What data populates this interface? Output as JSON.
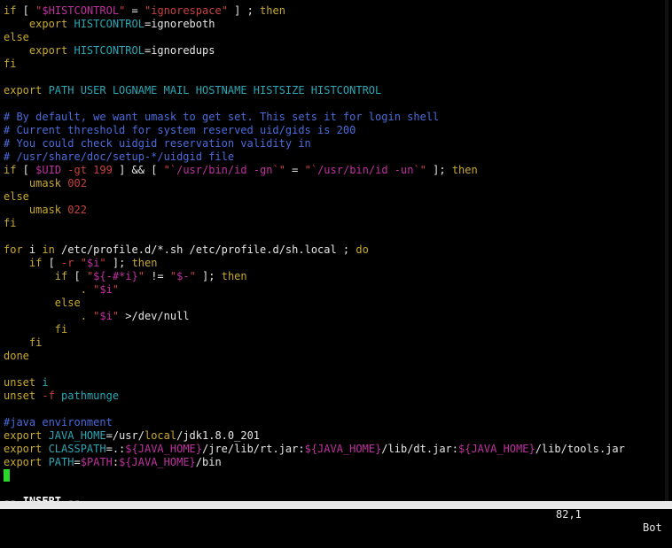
{
  "colors": {
    "background": "#000000",
    "keyword": "#c8aa32",
    "variable": "#c0309f",
    "string": "#c94040",
    "command": "#2aa7b5",
    "comment": "#4b6cdc",
    "text": "#e6e6e6",
    "cursor": "#2bd62b"
  },
  "editor": {
    "lines": [
      [
        {
          "t": "if",
          "c": "kw"
        },
        {
          "t": " [ ",
          "c": "id"
        },
        {
          "t": "\"",
          "c": "str"
        },
        {
          "t": "$HISTCONTROL",
          "c": "var"
        },
        {
          "t": "\"",
          "c": "str"
        },
        {
          "t": " = ",
          "c": "id"
        },
        {
          "t": "\"ignorespace\"",
          "c": "str"
        },
        {
          "t": " ] ; ",
          "c": "id"
        },
        {
          "t": "then",
          "c": "kw"
        }
      ],
      [
        {
          "t": "    export ",
          "c": "kw"
        },
        {
          "t": "HISTCONTROL",
          "c": "cmd"
        },
        {
          "t": "=ignoreboth",
          "c": "id"
        }
      ],
      [
        {
          "t": "else",
          "c": "kw"
        }
      ],
      [
        {
          "t": "    export ",
          "c": "kw"
        },
        {
          "t": "HISTCONTROL",
          "c": "cmd"
        },
        {
          "t": "=ignoredups",
          "c": "id"
        }
      ],
      [
        {
          "t": "fi",
          "c": "kw"
        }
      ],
      [],
      [
        {
          "t": "export ",
          "c": "kw"
        },
        {
          "t": "PATH USER LOGNAME MAIL HOSTNAME HISTSIZE HISTCONTROL",
          "c": "cmd"
        }
      ],
      [],
      [
        {
          "t": "# By default, we want umask to get set. This sets it for login shell",
          "c": "cmt"
        }
      ],
      [
        {
          "t": "# Current threshold for system reserved uid/gids is 200",
          "c": "cmt"
        }
      ],
      [
        {
          "t": "# You could check uidgid reservation validity in",
          "c": "cmt"
        }
      ],
      [
        {
          "t": "# /usr/share/doc/setup-*/uidgid file",
          "c": "cmt"
        }
      ],
      [
        {
          "t": "if",
          "c": "kw"
        },
        {
          "t": " [ ",
          "c": "id"
        },
        {
          "t": "$UID",
          "c": "var"
        },
        {
          "t": " -gt ",
          "c": "str"
        },
        {
          "t": "199",
          "c": "num"
        },
        {
          "t": " ] && [ ",
          "c": "id"
        },
        {
          "t": "\"`",
          "c": "str"
        },
        {
          "t": "/usr/bin/id -gn",
          "c": "var"
        },
        {
          "t": "`\"",
          "c": "str"
        },
        {
          "t": " = ",
          "c": "id"
        },
        {
          "t": "\"`",
          "c": "str"
        },
        {
          "t": "/usr/bin/id -un",
          "c": "var"
        },
        {
          "t": "`\"",
          "c": "str"
        },
        {
          "t": " ]; ",
          "c": "id"
        },
        {
          "t": "then",
          "c": "kw"
        }
      ],
      [
        {
          "t": "    umask ",
          "c": "kw"
        },
        {
          "t": "002",
          "c": "num"
        }
      ],
      [
        {
          "t": "else",
          "c": "kw"
        }
      ],
      [
        {
          "t": "    umask ",
          "c": "kw"
        },
        {
          "t": "022",
          "c": "num"
        }
      ],
      [
        {
          "t": "fi",
          "c": "kw"
        }
      ],
      [],
      [
        {
          "t": "for",
          "c": "kw"
        },
        {
          "t": " i ",
          "c": "id"
        },
        {
          "t": "in",
          "c": "kw"
        },
        {
          "t": " /etc/profile.d/*.sh /etc/profile.d/sh.local ; ",
          "c": "id"
        },
        {
          "t": "do",
          "c": "kw"
        }
      ],
      [
        {
          "t": "    if",
          "c": "kw"
        },
        {
          "t": " [ ",
          "c": "id"
        },
        {
          "t": "-r",
          "c": "str"
        },
        {
          "t": " ",
          "c": "id"
        },
        {
          "t": "\"",
          "c": "str"
        },
        {
          "t": "$i",
          "c": "var"
        },
        {
          "t": "\"",
          "c": "str"
        },
        {
          "t": " ]; ",
          "c": "id"
        },
        {
          "t": "then",
          "c": "kw"
        }
      ],
      [
        {
          "t": "        if",
          "c": "kw"
        },
        {
          "t": " [ ",
          "c": "id"
        },
        {
          "t": "\"",
          "c": "str"
        },
        {
          "t": "${-#*i}",
          "c": "var"
        },
        {
          "t": "\"",
          "c": "str"
        },
        {
          "t": " != ",
          "c": "id"
        },
        {
          "t": "\"",
          "c": "str"
        },
        {
          "t": "$-",
          "c": "var"
        },
        {
          "t": "\"",
          "c": "str"
        },
        {
          "t": " ]; ",
          "c": "id"
        },
        {
          "t": "then",
          "c": "kw"
        }
      ],
      [
        {
          "t": "            . ",
          "c": "kw"
        },
        {
          "t": "\"",
          "c": "str"
        },
        {
          "t": "$i",
          "c": "var"
        },
        {
          "t": "\"",
          "c": "str"
        }
      ],
      [
        {
          "t": "        else",
          "c": "kw"
        }
      ],
      [
        {
          "t": "            . ",
          "c": "kw"
        },
        {
          "t": "\"",
          "c": "str"
        },
        {
          "t": "$i",
          "c": "var"
        },
        {
          "t": "\"",
          "c": "str"
        },
        {
          "t": " >/dev/null",
          "c": "id"
        }
      ],
      [
        {
          "t": "        fi",
          "c": "kw"
        }
      ],
      [
        {
          "t": "    fi",
          "c": "kw"
        }
      ],
      [
        {
          "t": "done",
          "c": "kw"
        }
      ],
      [],
      [
        {
          "t": "unset ",
          "c": "kw"
        },
        {
          "t": "i",
          "c": "cmd"
        }
      ],
      [
        {
          "t": "unset ",
          "c": "kw"
        },
        {
          "t": "-f",
          "c": "str"
        },
        {
          "t": " ",
          "c": "id"
        },
        {
          "t": "pathmunge",
          "c": "cmd"
        }
      ],
      [],
      [
        {
          "t": "#java environment",
          "c": "cmt"
        }
      ],
      [
        {
          "t": "export ",
          "c": "kw"
        },
        {
          "t": "JAVA_HOME",
          "c": "cmd"
        },
        {
          "t": "=/usr/",
          "c": "id"
        },
        {
          "t": "local",
          "c": "kw"
        },
        {
          "t": "/jdk1.8.0_201",
          "c": "id"
        }
      ],
      [
        {
          "t": "export ",
          "c": "kw"
        },
        {
          "t": "CLASSPATH",
          "c": "cmd"
        },
        {
          "t": "=.:",
          "c": "id"
        },
        {
          "t": "${JAVA_HOME}",
          "c": "var"
        },
        {
          "t": "/jre/lib/rt.jar:",
          "c": "id"
        },
        {
          "t": "${JAVA_HOME}",
          "c": "var"
        },
        {
          "t": "/lib/dt.jar:",
          "c": "id"
        },
        {
          "t": "${JAVA_HOME}",
          "c": "var"
        },
        {
          "t": "/lib/tools.jar",
          "c": "id"
        }
      ],
      [
        {
          "t": "export ",
          "c": "kw"
        },
        {
          "t": "PATH",
          "c": "cmd"
        },
        {
          "t": "=",
          "c": "id"
        },
        {
          "t": "$PATH",
          "c": "var"
        },
        {
          "t": ":",
          "c": "id"
        },
        {
          "t": "${JAVA_HOME}",
          "c": "var"
        },
        {
          "t": "/bin",
          "c": "id"
        }
      ],
      [
        {
          "cursor": true
        }
      ]
    ]
  },
  "status": {
    "mode": "-- INSERT --",
    "cursor_position": "82,1",
    "scroll_position": "Bot"
  }
}
